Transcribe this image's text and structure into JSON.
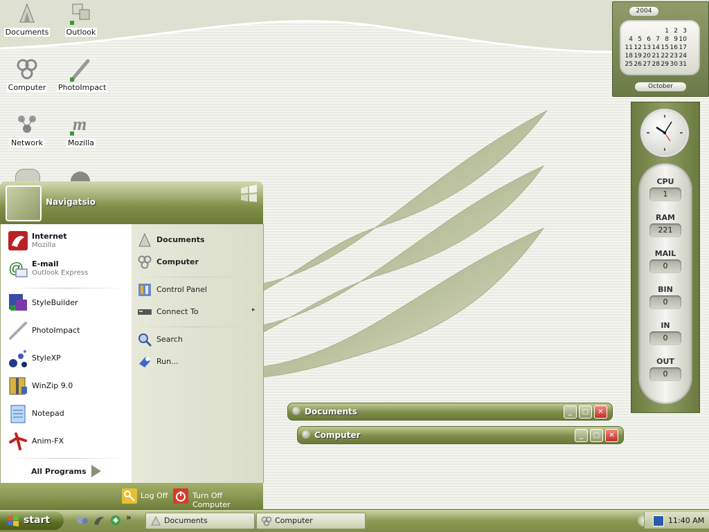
{
  "desktop": {
    "icons": [
      {
        "label": "Documents"
      },
      {
        "label": "Outlook"
      },
      {
        "label": "Computer"
      },
      {
        "label": "PhotoImpact"
      },
      {
        "label": "Network"
      },
      {
        "label": "Mozilla"
      }
    ]
  },
  "calendar": {
    "year": "2004",
    "month": "October",
    "weeks": [
      [
        "",
        "",
        "",
        "",
        "1",
        "2",
        "3"
      ],
      [
        "4",
        "5",
        "6",
        "7",
        "8",
        "9",
        "10"
      ],
      [
        "11",
        "12",
        "13",
        "14",
        "15",
        "16",
        "17"
      ],
      [
        "18",
        "19",
        "20",
        "21",
        "22",
        "23",
        "24"
      ],
      [
        "25",
        "26",
        "27",
        "28",
        "29",
        "30",
        "31"
      ]
    ]
  },
  "monitor": {
    "stats": [
      {
        "label": "CPU",
        "value": "1"
      },
      {
        "label": "RAM",
        "value": "221"
      },
      {
        "label": "MAIL",
        "value": "0"
      },
      {
        "label": "BIN",
        "value": "0"
      },
      {
        "label": "IN",
        "value": "0"
      },
      {
        "label": "OUT",
        "value": "0"
      }
    ]
  },
  "windows": [
    {
      "title": "Documents"
    },
    {
      "title": "Computer"
    }
  ],
  "start_menu": {
    "user_name": "Navigatsio",
    "pinned": [
      {
        "title": "Internet",
        "subtitle": "Mozilla"
      },
      {
        "title": "E-mail",
        "subtitle": "Outlook Express"
      }
    ],
    "recent": [
      {
        "title": "StyleBuilder"
      },
      {
        "title": "PhotoImpact"
      },
      {
        "title": "StyleXP"
      },
      {
        "title": "WinZip 9.0"
      },
      {
        "title": "Notepad"
      },
      {
        "title": "Anim-FX"
      }
    ],
    "all_programs": "All Programs",
    "places": [
      {
        "label": "Documents"
      },
      {
        "label": "Computer"
      },
      {
        "label": "Control Panel"
      },
      {
        "label": "Connect To"
      },
      {
        "label": "Search"
      },
      {
        "label": "Run..."
      }
    ],
    "log_off": "Log Off",
    "turn_off": "Turn Off Computer"
  },
  "taskbar": {
    "start_label": "start",
    "tasks": [
      {
        "title": "Documents"
      },
      {
        "title": "Computer"
      }
    ],
    "clock": "11:40 AM"
  }
}
